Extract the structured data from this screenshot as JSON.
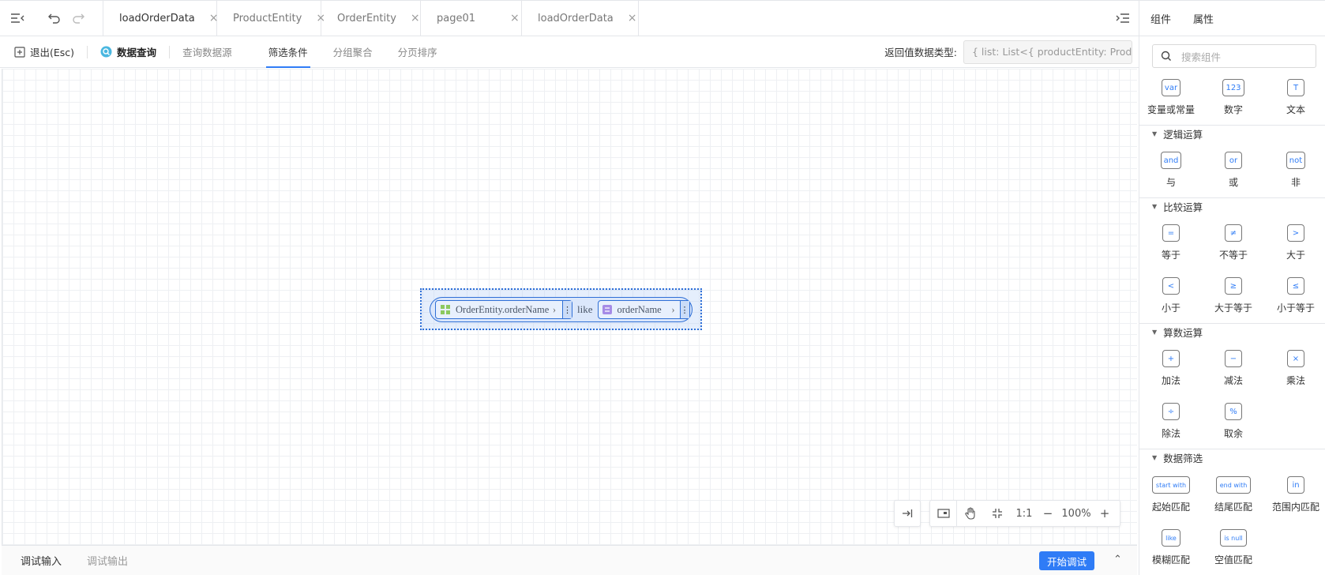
{
  "tabs": [
    {
      "label": "loadOrderData",
      "icon": "logic-icon",
      "active": true
    },
    {
      "label": "ProductEntity",
      "icon": "entity-icon",
      "active": false
    },
    {
      "label": "OrderEntity",
      "icon": "entity-icon",
      "active": false
    },
    {
      "label": "page01",
      "icon": "page-icon",
      "active": false
    },
    {
      "label": "loadOrderData",
      "icon": "logic-icon",
      "active": false
    }
  ],
  "subbar": {
    "exit_label": "退出(Esc)",
    "query_title": "数据查询",
    "items": [
      "查询数据源",
      "筛选条件",
      "分组聚合",
      "分页排序"
    ],
    "active_item": "筛选条件",
    "return_type_label": "返回值数据类型:",
    "return_type_value": "{ list: List<{ productEntity: Product"
  },
  "expression": {
    "left": "OrderEntity.orderName",
    "operator": "like",
    "right": "orderName"
  },
  "zoom": {
    "one_to_one": "1:1",
    "level": "100%",
    "minus": "−",
    "plus": "+"
  },
  "bottom": {
    "tab_input": "调试输入",
    "tab_output": "调试输出",
    "start_debug": "开始调试"
  },
  "panel": {
    "tab_components": "组件",
    "tab_props": "属性",
    "search_placeholder": "搜索组件",
    "basic": [
      {
        "icon_text": "var",
        "label": "变量或常量"
      },
      {
        "icon_text": "123",
        "label": "数字"
      },
      {
        "icon_text": "T",
        "label": "文本"
      }
    ],
    "logic_title": "逻辑运算",
    "logic": [
      {
        "icon_text": "and",
        "label": "与"
      },
      {
        "icon_text": "or",
        "label": "或"
      },
      {
        "icon_text": "not",
        "label": "非"
      }
    ],
    "compare_title": "比较运算",
    "compare": [
      {
        "icon_text": "=",
        "label": "等于"
      },
      {
        "icon_text": "≠",
        "label": "不等于"
      },
      {
        "icon_text": ">",
        "label": "大于"
      },
      {
        "icon_text": "<",
        "label": "小于"
      },
      {
        "icon_text": "≥",
        "label": "大于等于"
      },
      {
        "icon_text": "≤",
        "label": "小于等于"
      }
    ],
    "arith_title": "算数运算",
    "arith": [
      {
        "icon_text": "+",
        "label": "加法"
      },
      {
        "icon_text": "−",
        "label": "减法"
      },
      {
        "icon_text": "×",
        "label": "乘法"
      },
      {
        "icon_text": "÷",
        "label": "除法"
      },
      {
        "icon_text": "%",
        "label": "取余"
      }
    ],
    "filter_title": "数据筛选",
    "filter": [
      {
        "icon_text": "start with",
        "label": "起始匹配"
      },
      {
        "icon_text": "end with",
        "label": "结尾匹配"
      },
      {
        "icon_text": "in",
        "label": "范围内匹配"
      },
      {
        "icon_text": "like",
        "label": "模糊匹配"
      },
      {
        "icon_text": "is null",
        "label": "空值匹配"
      }
    ]
  },
  "colors": {
    "accent": "#2f7cf6",
    "border": "#e4e6ea"
  }
}
